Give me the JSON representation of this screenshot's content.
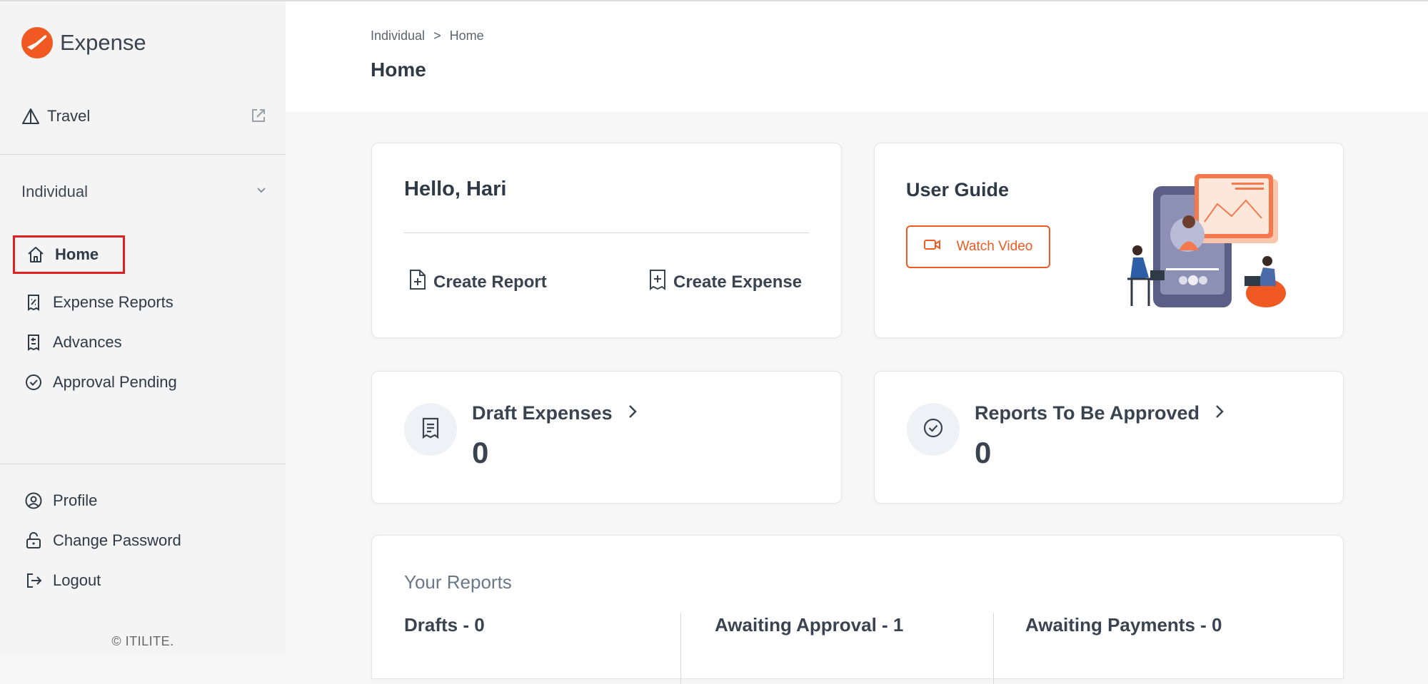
{
  "sidebar": {
    "brand": "Expense",
    "travel_label": "Travel",
    "section_label": "Individual",
    "nav": [
      {
        "label": "Home",
        "icon": "home-icon"
      },
      {
        "label": "Expense Reports",
        "icon": "expense-report-icon"
      },
      {
        "label": "Advances",
        "icon": "advances-icon"
      },
      {
        "label": "Approval Pending",
        "icon": "check-circle-icon"
      }
    ],
    "bottom": [
      {
        "label": "Profile",
        "icon": "profile-icon"
      },
      {
        "label": "Change Password",
        "icon": "lock-icon"
      },
      {
        "label": "Logout",
        "icon": "logout-icon"
      }
    ],
    "copyright": "© ITILITE."
  },
  "header": {
    "breadcrumb": [
      "Individual",
      ">",
      "Home"
    ],
    "title": "Home"
  },
  "hello_card": {
    "greeting": "Hello, Hari",
    "create_report": "Create Report",
    "create_expense": "Create Expense"
  },
  "guide_card": {
    "title": "User Guide",
    "watch_video": "Watch Video"
  },
  "stats": {
    "draft_label": "Draft Expenses",
    "draft_value": "0",
    "approve_label": "Reports To Be Approved",
    "approve_value": "0"
  },
  "reports": {
    "title": "Your Reports",
    "drafts": "Drafts - 0",
    "awaiting_approval": "Awaiting Approval - 1",
    "awaiting_payments": "Awaiting Payments - 0"
  },
  "colors": {
    "accent": "#f05a22",
    "highlight_border": "#e02020",
    "text": "#2f3a47"
  }
}
